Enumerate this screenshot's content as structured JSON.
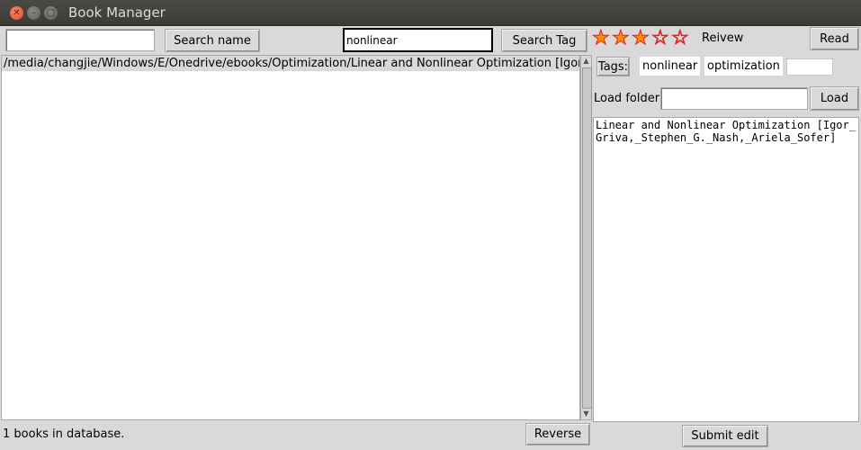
{
  "window": {
    "title": "Book Manager"
  },
  "search": {
    "name_value": "",
    "name_button": "Search name",
    "tag_value": "nonlinear",
    "tag_button": "Search Tag"
  },
  "rating": {
    "value": 3,
    "max": 5
  },
  "review_label": "Reivew",
  "read_button": "Read",
  "tags": {
    "button": "Tags:",
    "items": [
      "nonlinear",
      "optimization",
      ""
    ]
  },
  "load": {
    "label": "Load folder:",
    "value": "",
    "button": "Load"
  },
  "results": [
    "/media/changjie/Windows/E/Onedrive/ebooks/Optimization/Linear and Nonlinear Optimization [Igor_Griva,_"
  ],
  "detail_text": "Linear and Nonlinear Optimization [Igor_Griva,_Stephen_G._Nash,_Ariela_Sofer]",
  "status": "1 books in database.",
  "reverse_button": "Reverse",
  "submit_button": "Submit edit",
  "colors": {
    "star_fill": "#ff8c00",
    "star_outline": "#dd2222",
    "titlebar": "#3c3b37"
  }
}
